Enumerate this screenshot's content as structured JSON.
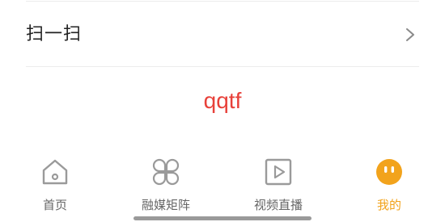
{
  "menu": {
    "scan_label": "扫一扫"
  },
  "profile": {
    "username": "qqtf"
  },
  "tabbar": {
    "tabs": [
      {
        "label": "首页",
        "icon": "home-icon",
        "active": false
      },
      {
        "label": "融媒矩阵",
        "icon": "clover-grid-icon",
        "active": false
      },
      {
        "label": "视频直播",
        "icon": "play-video-icon",
        "active": false
      },
      {
        "label": "我的",
        "icon": "face-icon",
        "active": true
      }
    ]
  },
  "colors": {
    "accent": "#f2a31c",
    "username": "#e8413a",
    "icon_inactive": "#9a9a9a",
    "label_inactive": "#666666"
  }
}
